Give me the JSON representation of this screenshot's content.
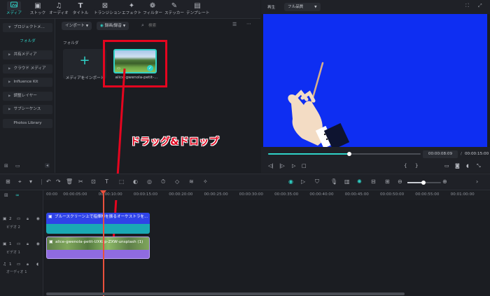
{
  "toolbar": {
    "tabs": [
      {
        "label": "メディア",
        "icon": "media-icon"
      },
      {
        "label": "ストック",
        "icon": "stock-icon"
      },
      {
        "label": "オーディオ",
        "icon": "audio-icon"
      },
      {
        "label": "タイトル",
        "icon": "title-icon"
      },
      {
        "label": "トランジション",
        "icon": "transition-icon"
      },
      {
        "label": "エフェクト",
        "icon": "effect-icon"
      },
      {
        "label": "フィルター",
        "icon": "filter-icon"
      },
      {
        "label": "ステッカー",
        "icon": "sticker-icon"
      },
      {
        "label": "テンプレート",
        "icon": "template-icon"
      }
    ],
    "accent": "#2fd2c7"
  },
  "sidebar": {
    "items": [
      {
        "label": "プロジェクトメ..."
      },
      {
        "label": "フォルダ"
      },
      {
        "label": "共有メディア"
      },
      {
        "label": "クラウド メディア"
      },
      {
        "label": "Influence Kit"
      },
      {
        "label": "調整レイヤー"
      },
      {
        "label": "サブシーケンス"
      },
      {
        "label": "Photos Library"
      }
    ]
  },
  "media": {
    "import_button": "インポート",
    "record_button": "録画/録音",
    "search_placeholder": "検索",
    "folder_label": "フォルダ",
    "import_tile_label": "メディアをインポート",
    "clip_label": "alice-gwenola-petit-..."
  },
  "preview": {
    "play_label": "再生",
    "quality": "フル品質",
    "current_time": "00:00:08:09",
    "separator": "/",
    "total_time": "00:00:15:00",
    "progress": 0.53,
    "background": "#0e2ef2"
  },
  "annotation": {
    "text": "ドラッグ&ドロップ",
    "color": "#e4051f"
  },
  "timeline": {
    "ticks": [
      "00:00",
      "00:00:05:00",
      "00:00:10:00",
      "00:00:15:00",
      "00:00:20:00",
      "00:00:25:00",
      "00:00:30:00",
      "00:00:35:00",
      "00:00:40:00",
      "00:00:45:00",
      "00:00:50:00",
      "00:00:55:00",
      "00:01:00:00"
    ],
    "tracks": [
      {
        "number": "2",
        "name": "ビデオ 2"
      },
      {
        "number": "1",
        "name": "ビデオ 1"
      },
      {
        "number": "1",
        "name": "オーディオ 1"
      }
    ],
    "clip_v2": "ブルースクリーン上で指揮棒を振るオーケストラを...",
    "clip_v1": "alice-gwenola-petit-UXKsp-ZXW-unsplash (1)"
  }
}
